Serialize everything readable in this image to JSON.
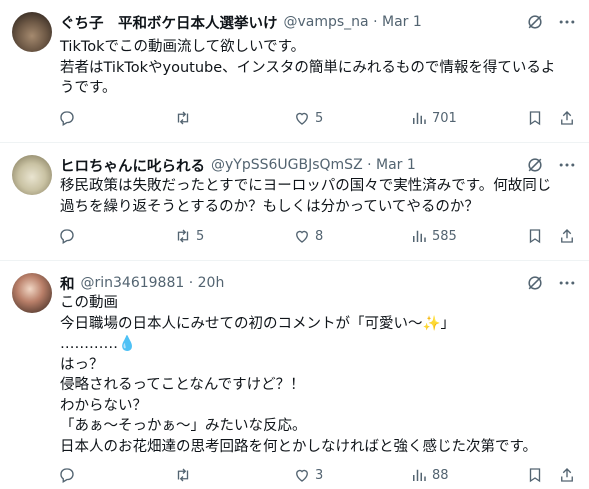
{
  "tweets": [
    {
      "name": "ぐち子　平和ボケ日本人選挙いけ",
      "handle": "@vamps_na · Mar 1",
      "lines": [
        "TikTokでこの動画流して欲しいです。",
        "若者はTikTokやyoutube、インスタの簡単にみれるもので情報を得ているよ",
        "うです。"
      ],
      "replies": "",
      "retweets": "",
      "likes": "5",
      "views": "701"
    },
    {
      "name": "ヒロちゃんに叱られる",
      "handle": "@yYpSS6UGBJsQmSZ · Mar 1",
      "lines": [
        "移民政策は失敗だったとすでにヨーロッパの国々で実性済みです。何故同じ",
        "過ちを繰り返そうとするのか？もしくは分かっていてやるのか？"
      ],
      "replies": "",
      "retweets": "5",
      "likes": "8",
      "views": "585"
    },
    {
      "name": "和",
      "handle": "@rin34619881 · 20h",
      "lines": [
        "この動画",
        "今日職場の日本人にみせての初のコメントが「可愛い〜✨」",
        "…………💧",
        "はっ？",
        "侵略されるってことなんですけど？！",
        "わからない？",
        "「あぁ〜そっかぁ〜」みたいな反応。",
        "日本人のお花畑達の思考回路を何とかしなければと強く感じた次第です。"
      ],
      "replies": "",
      "retweets": "",
      "likes": "3",
      "views": "88"
    }
  ],
  "icons": {
    "reply": "reply-icon",
    "retweet": "retweet-icon",
    "like": "heart-icon",
    "views": "views-icon",
    "bookmark": "bookmark-icon",
    "share": "share-icon",
    "grok": "grok-icon",
    "more": "more-icon"
  },
  "colors": {
    "text": "#0f1419",
    "muted": "#536471",
    "border": "#eff3f4"
  }
}
